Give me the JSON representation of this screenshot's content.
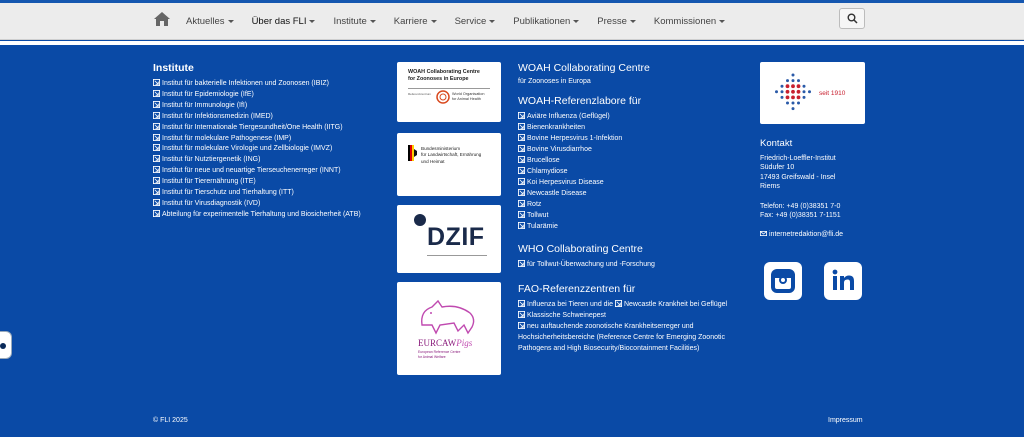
{
  "nav": {
    "home_icon": "home-icon",
    "items": [
      {
        "label": "Aktuelles",
        "dropdown": true,
        "active": false
      },
      {
        "label": "Über das FLI",
        "dropdown": true,
        "active": true
      },
      {
        "label": "Institute",
        "dropdown": true,
        "active": false
      },
      {
        "label": "Karriere",
        "dropdown": true,
        "active": false
      },
      {
        "label": "Service",
        "dropdown": true,
        "active": false
      },
      {
        "label": "Publikationen",
        "dropdown": true,
        "active": false
      },
      {
        "label": "Presse",
        "dropdown": true,
        "active": false
      },
      {
        "label": "Kommissionen",
        "dropdown": true,
        "active": false
      }
    ],
    "search_icon": "search-icon"
  },
  "institute": {
    "heading": "Institute",
    "items": [
      "Institut für bakterielle Infektionen und Zoonosen (IBIZ)",
      "Institut für Epidemiologie (IfE)",
      "Institut für Immunologie (IfI)",
      "Institut für Infektionsmedizin (IMED)",
      "Institut für Internationale Tiergesundheit/One Health (IITG)",
      "Institut für molekulare Pathogenese (IMP)",
      "Institut für molekulare Virologie und Zellbiologie (IMVZ)",
      "Institut für Nutztiergenetik (ING)",
      "Institut für neue und neuartige Tierseuchenerreger (INNT)",
      "Institut für Tierernährung (ITE)",
      "Institut für Tierschutz und Tierhaltung (ITT)",
      "Institut für Virusdiagnostik (IVD)",
      "Abteilung für experimentelle Tierhaltung und Biosicherheit (ATB)"
    ]
  },
  "logos": {
    "woah": {
      "line1": "WOAH Collaborating Centre",
      "line2": "for Zoonoses in Europe",
      "left": "Referenzzentrum",
      "org1": "World Organisation",
      "org2": "for Animal Health"
    },
    "bmel": {
      "line1": "Bundesministerium",
      "line2": "für Landwirtschaft, Ernährung",
      "line3": "und Heimat"
    },
    "dzif": {
      "text": "DZIF"
    },
    "eurcaw": {
      "text": "EURCAW",
      "italic": "Pigs",
      "sub1": "European Reference Centre",
      "sub2": "for Animal Welfare"
    }
  },
  "woah_centre": {
    "heading": "WOAH Collaborating Centre",
    "sub": "für Zoonoses in Europa"
  },
  "woah_labs": {
    "heading": "WOAH-Referenzlabore für",
    "items": [
      "Aviäre Influenza (Geflügel)",
      "Bienenkrankheiten",
      "Bovine Herpesvirus 1-Infektion",
      "Bovine Virusdiarrhoe",
      "Brucellose",
      "Chlamydiose",
      "Koi Herpesvirus Disease",
      "Newcastle Disease",
      "Rotz",
      "Tollwut",
      "Tularämie"
    ]
  },
  "who": {
    "heading": "WHO Collaborating Centre",
    "items": [
      "für Tollwut-Überwachung und -Forschung"
    ]
  },
  "fao": {
    "heading": "FAO-Referenzzentren für",
    "item1_a": "Influenza bei Tieren und die",
    "item1_b": "Newcastle Krankheit bei Geflügel",
    "item2": "Klassische Schweinepest",
    "item3": "neu auftauchende zoonotische Krankheitserreger und Hochsicherheitsbereiche (Reference Centre for Emerging Zoonotic Pathogens and High Biosecurity/Biocontainment Facilities)"
  },
  "fli_logo": {
    "seit": "seit 1910"
  },
  "contact": {
    "heading": "Kontakt",
    "lines": [
      "Friedrich-Loeffler-Institut",
      "Südufer 10",
      "17493 Greifswald - Insel",
      "Riems"
    ],
    "phone": "Telefon: +49 (0)38351 7-0",
    "fax": "Fax: +49 (0)38351 7-1151",
    "email": "internetredaktion@fli.de"
  },
  "social": {
    "instagram": "instagram-icon",
    "linkedin": "linkedin-icon"
  },
  "bottom": {
    "copyright": "© FLI 2025",
    "impressum": "Impressum"
  },
  "colors": {
    "footer_bg": "#0a4aa6",
    "nav_bg": "#ececec",
    "fli_red": "#c8202f"
  }
}
